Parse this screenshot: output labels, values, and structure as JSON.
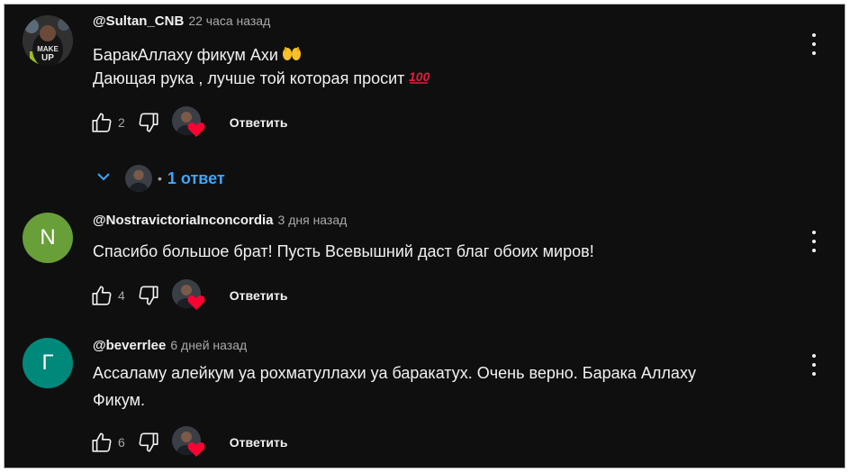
{
  "comments": [
    {
      "author": "@Sultan_CNB",
      "time": "22 часа назад",
      "lines": [
        "БаракАллаху фикум Ахи",
        "Дающая рука , лучше той которая просит"
      ],
      "likes": "2",
      "reply_label": "Ответить",
      "replies": {
        "label": "1 ответ"
      }
    },
    {
      "author": "@NostravictoriaInconcordia",
      "time": "3 дня назад",
      "avatar_letter": "N",
      "avatar_color": "#689f38",
      "lines": [
        "Спасибо большое брат! Пусть Всевышний даст благ обоих миров!"
      ],
      "likes": "4",
      "reply_label": "Ответить"
    },
    {
      "author": "@beverrlee",
      "time": "6 дней назад",
      "avatar_letter": "Г",
      "avatar_color": "#00897b",
      "lines": [
        "Ассаламу алейкум уа рохматуллахи уа баракатух. Очень верно. Барака Аллаху",
        "Фикум."
      ],
      "likes": "6",
      "reply_label": "Ответить"
    }
  ],
  "icons": {
    "like": "thumbs-up-icon",
    "dislike": "thumbs-down-icon",
    "menu": "more-vertical-icon",
    "heart": "heart-icon",
    "chevron": "chevron-down-icon",
    "hands": "open-hands-emoji",
    "hundred": "hundred-points-emoji"
  },
  "colors": {
    "background": "#0f0f0f",
    "text": "#f1f1f1",
    "secondary": "#aaaaaa",
    "link": "#3ea6ff",
    "heart": "#ff0033"
  }
}
